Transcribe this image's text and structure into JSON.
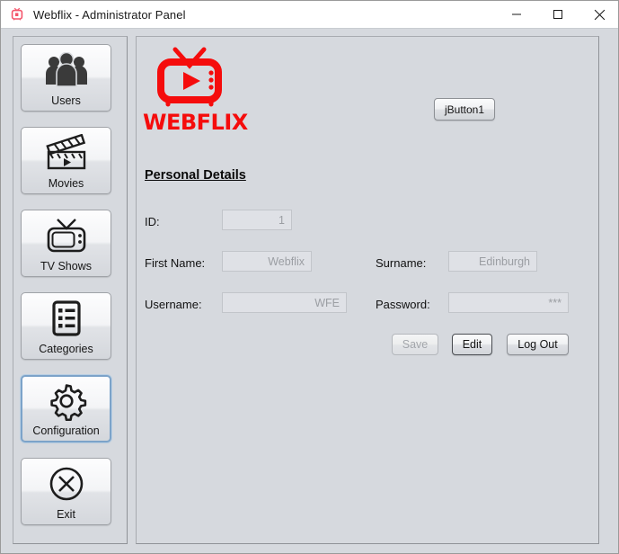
{
  "window": {
    "title": "Webflix - Administrator Panel",
    "icon": "webflix-tv-icon",
    "controls": {
      "minimize": "minimize-icon",
      "maximize": "maximize-icon",
      "close": "close-icon"
    }
  },
  "sidebar": {
    "items": [
      {
        "label": "Users",
        "icon": "users-group-icon",
        "selected": false
      },
      {
        "label": "Movies",
        "icon": "clapperboard-icon",
        "selected": false
      },
      {
        "label": "TV Shows",
        "icon": "retro-tv-icon",
        "selected": false
      },
      {
        "label": "Categories",
        "icon": "list-clipboard-icon",
        "selected": false
      },
      {
        "label": "Configuration",
        "icon": "gear-icon",
        "selected": true
      },
      {
        "label": "Exit",
        "icon": "circle-x-icon",
        "selected": false
      }
    ]
  },
  "logo": {
    "icon": "webflix-tv-play-icon",
    "text": "WEBFLIX",
    "color": "#f50c0c"
  },
  "toolbar": {
    "jbutton1_label": "jButton1"
  },
  "main": {
    "section_title": "Personal Details",
    "fields": {
      "id": {
        "label": "ID:",
        "value": "1",
        "placeholder": "",
        "disabled": true
      },
      "first_name": {
        "label": "First Name:",
        "value": "Webflix",
        "placeholder": "",
        "disabled": true
      },
      "surname": {
        "label": "Surname:",
        "value": "Edinburgh",
        "placeholder": "",
        "disabled": true
      },
      "username": {
        "label": "Username:",
        "value": "WFE",
        "placeholder": "",
        "disabled": true
      },
      "password": {
        "label": "Password:",
        "value": "***",
        "placeholder": "",
        "disabled": true
      }
    },
    "actions": [
      {
        "label": "Save",
        "state": "disabled"
      },
      {
        "label": "Edit",
        "state": "focused"
      },
      {
        "label": "Log Out",
        "state": "normal"
      }
    ]
  }
}
